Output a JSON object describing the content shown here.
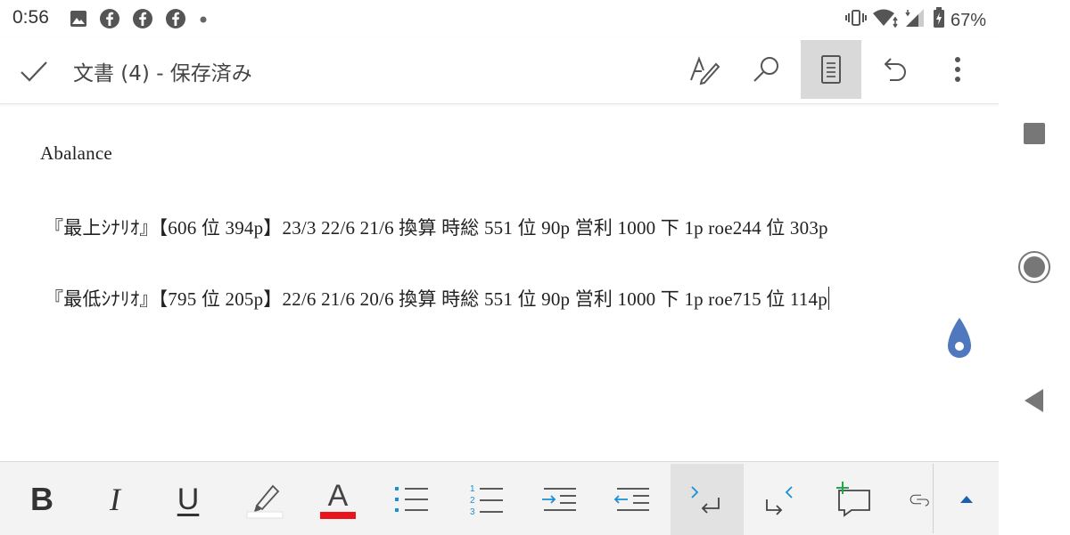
{
  "status_bar": {
    "time": "0:56",
    "battery": "67%",
    "left_icons": [
      "image-icon",
      "facebook-icon",
      "facebook-icon",
      "facebook-icon",
      "dot-icon"
    ],
    "right_icons": [
      "vibrate-icon",
      "wifi-icon",
      "signal-icon",
      "battery-icon"
    ]
  },
  "app_bar": {
    "title": "文書 (4) - 保存済み",
    "actions": [
      "draw-pen-icon",
      "search-icon",
      "mobile-view-icon",
      "undo-icon",
      "more-vert-icon"
    ]
  },
  "document": {
    "lines": [
      "Abalance",
      "『最上ｼﾅﾘｵ』【606 位 394p】23/3 22/6 21/6 換算  時総 551 位 90p  営利 1000 下 1p    roe244 位 303p",
      "『最低ｼﾅﾘｵ』【795 位 205p】22/6 21/6 20/6 換算  時総 551 位 90p  営利 1000 下 1p    roe715 位 114p"
    ]
  },
  "toolbar": {
    "bold_label": "B",
    "italic_label": "I",
    "underline_label": "U",
    "font_color_label": "A",
    "highlight_color": "#ffffff",
    "font_color": "#e8151b",
    "accent_color": "#1b8fd6"
  },
  "nav_bar": {
    "buttons": [
      "recents-square-icon",
      "home-circle-icon",
      "back-triangle-icon"
    ]
  },
  "colors": {
    "handle": "#4f78be",
    "insert_green": "#22a84a"
  }
}
